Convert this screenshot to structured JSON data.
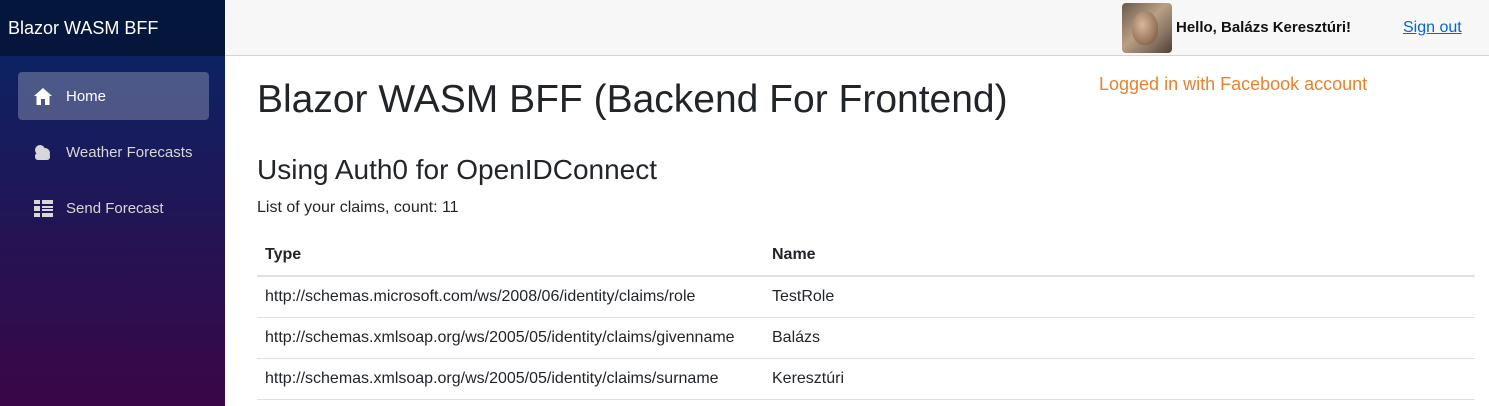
{
  "brand": "Blazor WASM BFF",
  "nav": {
    "items": [
      {
        "label": "Home",
        "icon": "home-icon",
        "active": true
      },
      {
        "label": "Weather Forecasts",
        "icon": "cloud-icon",
        "active": false
      },
      {
        "label": "Send Forecast",
        "icon": "list-icon",
        "active": false
      }
    ]
  },
  "topbar": {
    "greeting": "Hello, Balázs Keresztúri!",
    "signout": "Sign out"
  },
  "main": {
    "title": "Blazor WASM BFF (Backend For Frontend)",
    "login_note": "Logged in with Facebook account",
    "subtitle": "Using Auth0 for OpenIDConnect",
    "count_text": "List of your claims, count: 11",
    "table": {
      "headers": [
        "Type",
        "Name"
      ],
      "rows": [
        [
          "http://schemas.microsoft.com/ws/2008/06/identity/claims/role",
          "TestRole"
        ],
        [
          "http://schemas.xmlsoap.org/ws/2005/05/identity/claims/givenname",
          "Balázs"
        ],
        [
          "http://schemas.xmlsoap.org/ws/2005/05/identity/claims/surname",
          "Keresztúri"
        ]
      ]
    }
  },
  "colors": {
    "sidebar_top": "#052767",
    "sidebar_bottom": "#3a0647",
    "link": "#0366d6",
    "note": "#e9822e"
  }
}
